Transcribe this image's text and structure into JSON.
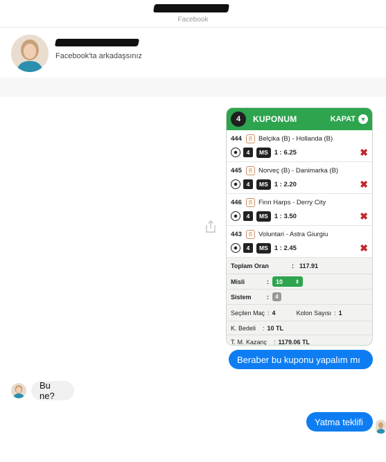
{
  "header": {
    "source_label": "Facebook"
  },
  "profile": {
    "status": "Facebook'ta arkadaşsınız"
  },
  "coupon": {
    "count": "4",
    "title": "KUPONUM",
    "close_label": "KAPAT",
    "close_icon": "chevron-down",
    "matches": [
      {
        "id": "444",
        "badge": "B",
        "teams": "Belçika (B) - Hollanda (B)",
        "num": "4",
        "ms": "MS",
        "odds": "1 : 6.25"
      },
      {
        "id": "445",
        "badge": "B",
        "teams": "Norveç (B) - Danimarka (B)",
        "num": "4",
        "ms": "MS",
        "odds": "1 : 2.20"
      },
      {
        "id": "446",
        "badge": "B",
        "teams": "Finn Harps - Derry City",
        "num": "4",
        "ms": "MS",
        "odds": "1 : 3.50"
      },
      {
        "id": "443",
        "badge": "B",
        "teams": "Voluntari - Astra Giurgiu",
        "num": "4",
        "ms": "MS",
        "odds": "1 : 2.45"
      }
    ],
    "toplam_oran_label": "Toplam Oran",
    "toplam_oran_value": "117.91",
    "misli_label": "Misli",
    "misli_value": "10",
    "sistem_label": "Sistem",
    "sistem_value": "4",
    "secilen_mac_label": "Seçilen Maç",
    "secilen_mac_value": "4",
    "kolon_sayisi_label": "Kolon Sayısı",
    "kolon_sayisi_value": "1",
    "k_bedeli_label": "K. Bedeli",
    "k_bedeli_value": "10 TL",
    "tm_kazanc_label": "T. M. Kazanç",
    "tm_kazanc_value": "1179.06 TL",
    "accent": "#2ea44f"
  },
  "messages": [
    {
      "text": "Beraber bu kuponu yapalım mı",
      "direction": "outgoing"
    },
    {
      "text": "Bu ne?",
      "direction": "incoming"
    },
    {
      "text": "Yatma teklifi",
      "direction": "outgoing"
    }
  ],
  "colors": {
    "outgoing_bubble": "#0f7df2",
    "incoming_bubble": "#f0f0f0"
  }
}
